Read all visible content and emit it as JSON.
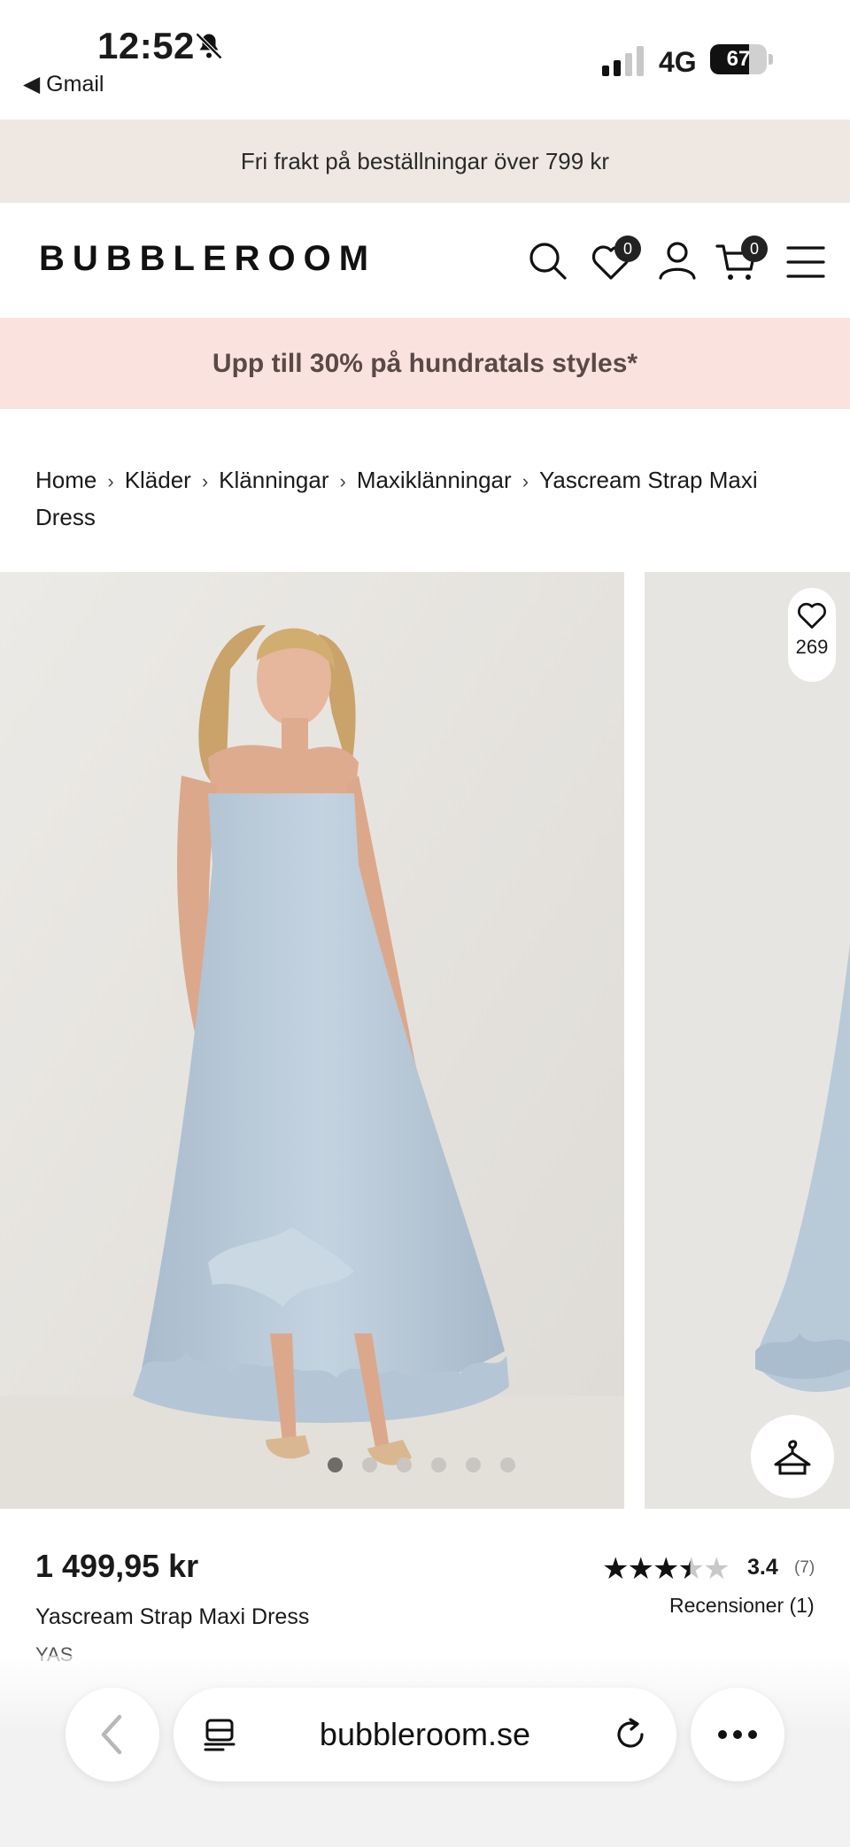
{
  "status_bar": {
    "time": "12:52",
    "back_app": "◀ Gmail",
    "network": "4G",
    "battery": "67"
  },
  "shipping_banner": "Fri frakt på beställningar över 799 kr",
  "header": {
    "logo": "BUBBLEROOM",
    "wishlist_count": "0",
    "cart_count": "0"
  },
  "sale_banner": "Upp till 30% på hundratals styles*",
  "breadcrumb": [
    "Home",
    "Kläder",
    "Klänningar",
    "Maxiklänningar",
    "Yascream Strap Maxi Dress"
  ],
  "gallery": {
    "favorites_count": "269",
    "image_count": 6,
    "active_index": 0,
    "dress_color": "#bfcfdd"
  },
  "product": {
    "price": "1 499,95 kr",
    "name": "Yascream Strap Maxi Dress",
    "brand": "YAS",
    "rating": "3.4",
    "rating_count": "(7)",
    "reviews_link": "Recensioner (1)"
  },
  "browser": {
    "url": "bubbleroom.se"
  },
  "icons": [
    "bell-slash-icon",
    "signal-icon",
    "battery-icon",
    "search-icon",
    "heart-icon",
    "user-icon",
    "cart-icon",
    "menu-icon",
    "hanger-icon",
    "chevron-left-icon",
    "reader-icon",
    "reload-icon",
    "more-icon"
  ]
}
